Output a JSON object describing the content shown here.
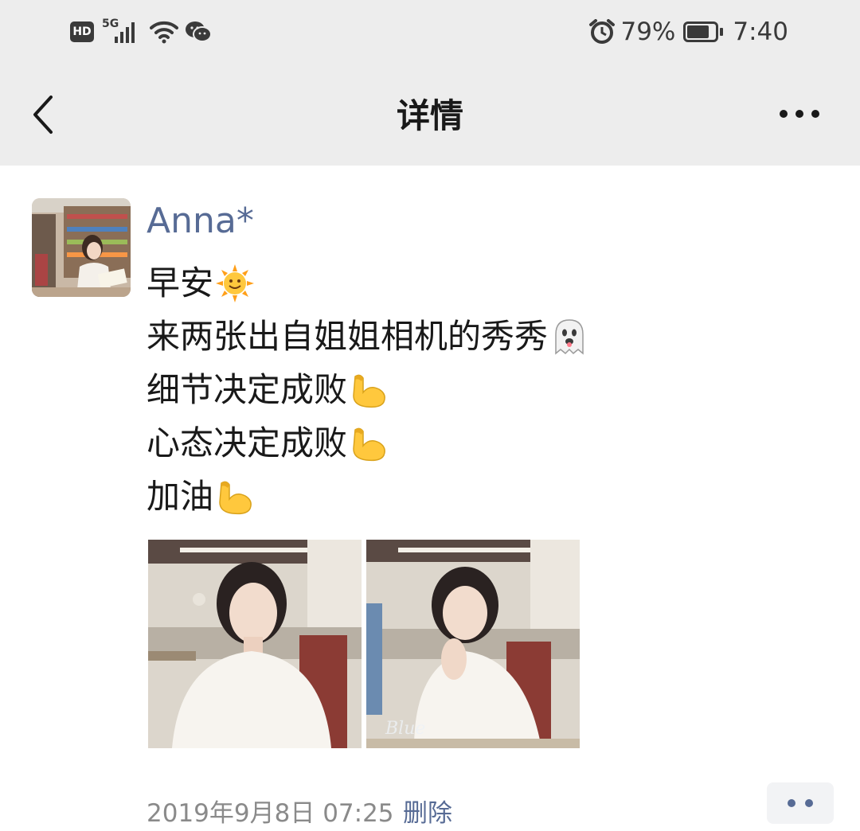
{
  "status_bar": {
    "hd_label": "HD",
    "network_label": "5G",
    "battery_percent": "79%",
    "battery_level": 0.79,
    "time": "7:40",
    "icons": [
      "hd-icon",
      "signal-icon",
      "wifi-icon",
      "wechat-icon",
      "alarm-icon",
      "battery-icon"
    ]
  },
  "nav": {
    "title": "详情",
    "back_icon": "back-arrow-icon",
    "more_icon": "more-icon"
  },
  "post": {
    "author": "Anna*",
    "lines": [
      {
        "text": "早安",
        "emoji": "sun-icon"
      },
      {
        "text": "来两张出自姐姐相机的秀秀",
        "emoji": "ghost-icon"
      },
      {
        "text": "细节决定成败",
        "emoji": "flexed-biceps-icon"
      },
      {
        "text": "心态决定成败",
        "emoji": "flexed-biceps-icon"
      },
      {
        "text": "加油",
        "emoji": "flexed-biceps-icon"
      }
    ],
    "photo_count": 2,
    "photo_watermark": "Blue",
    "timestamp": "2019年9月8日 07:25",
    "delete_label": "删除",
    "comment_icon": "comment-dots-icon"
  },
  "colors": {
    "link_blue": "#576b95",
    "header_bg": "#ededed",
    "text_dark": "#191919",
    "text_muted": "#8a8a8a"
  }
}
